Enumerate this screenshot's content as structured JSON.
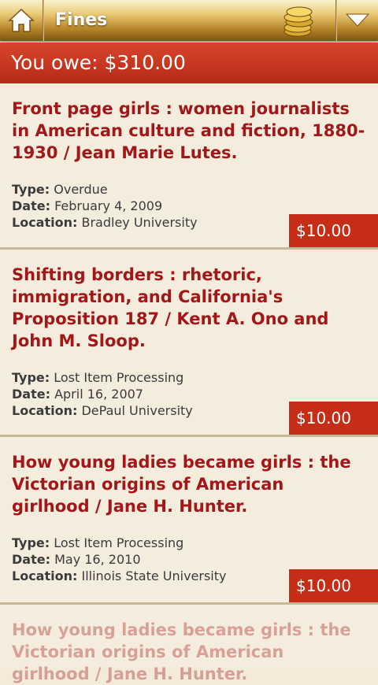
{
  "header": {
    "title": "Fines"
  },
  "summary": {
    "owe_text": "You owe: $310.00"
  },
  "labels": {
    "type": "Type:",
    "date": "Date:",
    "location": "Location:"
  },
  "fines": [
    {
      "title": "Front page girls : women journalists in American culture and fiction, 1880-1930 / Jean Marie Lutes.",
      "type": "Overdue",
      "date": "February 4, 2009",
      "location": "Bradley University",
      "amount": "$10.00"
    },
    {
      "title": "Shifting borders : rhetoric, immigration, and California's Proposition 187 / Kent A. Ono and John M. Sloop.",
      "type": "Lost Item Processing",
      "date": "April 16, 2007",
      "location": "DePaul University",
      "amount": "$10.00"
    },
    {
      "title": "How young ladies became girls : the Victorian origins of American girlhood / Jane H. Hunter.",
      "type": "Lost Item Processing",
      "date": "May 16, 2010",
      "location": "Illinois State University",
      "amount": "$10.00"
    },
    {
      "title": "How young ladies became girls : the Victorian origins of American girlhood / Jane H. Hunter.",
      "type": "",
      "date": "",
      "location": "",
      "amount": ""
    }
  ],
  "icons": {
    "home": "home-icon",
    "coins": "coins-icon",
    "menu": "dropdown-triangle-icon"
  },
  "colors": {
    "accent_red": "#c62d16",
    "title_red": "#a3171a",
    "bar_gold": "#d4a94d"
  }
}
